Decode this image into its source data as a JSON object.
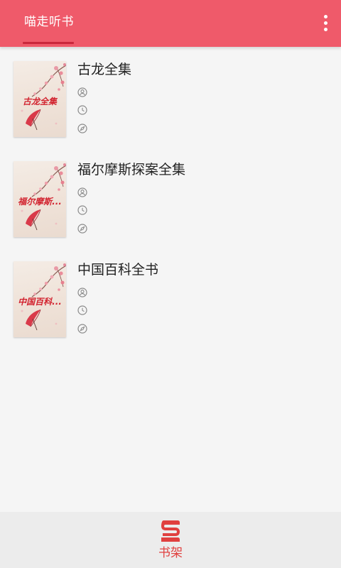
{
  "header": {
    "tab_label": "喵走听书",
    "menu_icon": "more-vertical-icon",
    "background_color": "#ef5a6a"
  },
  "books": [
    {
      "title": "古龙全集",
      "cover_text": "古龙全集",
      "icons": [
        "author-icon",
        "clock-icon",
        "compass-icon"
      ]
    },
    {
      "title": "福尔摩斯探案全集",
      "cover_text": "福尔摩斯...",
      "icons": [
        "author-icon",
        "clock-icon",
        "compass-icon"
      ]
    },
    {
      "title": "中国百科全书",
      "cover_text": "中国百科...",
      "icons": [
        "author-icon",
        "clock-icon",
        "compass-icon"
      ]
    }
  ],
  "bottom_nav": {
    "bookshelf_label": "书架",
    "bookshelf_icon": "bookshelf-icon",
    "accent_color": "#e0403f"
  }
}
